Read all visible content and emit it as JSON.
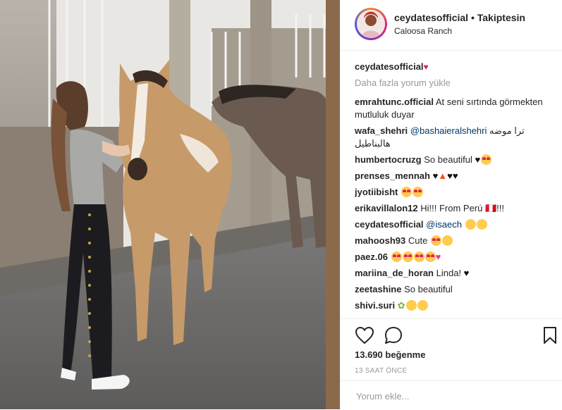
{
  "header": {
    "username": "ceydatesofficial",
    "separator": "•",
    "follow_label": "Takiptesin",
    "location": "Caloosa Ranch"
  },
  "caption": {
    "username": "ceydatesofficial",
    "emoji": "red-heart"
  },
  "load_more": "Daha fazla yorum yükle",
  "comments": [
    {
      "user": "emrahtunc.official",
      "text": "At seni sırtında görmekten mutluluk duyar"
    },
    {
      "user": "wafa_shehri",
      "mention": "@bashaieralshehri",
      "text": "ترا موضه هالبناطيل"
    },
    {
      "user": "humbertocruzg",
      "text": "So beautiful",
      "emojis": "♥😍"
    },
    {
      "user": "prenses_mennah",
      "text": "",
      "emojis": "♥🔥♥♥"
    },
    {
      "user": "jyotiibisht",
      "text": "",
      "emojis": "😍😍"
    },
    {
      "user": "erikavillalon12",
      "text": "Hi!!! From Perú 🇵🇪!!!"
    },
    {
      "user": "ceydatesofficial",
      "mention": "@isaech",
      "text": "",
      "emojis": "😘😘"
    },
    {
      "user": "mahoosh93",
      "text": "Cute",
      "emojis": "😍😘"
    },
    {
      "user": "paez.06",
      "text": "",
      "emojis": "😍😍😍😍💖"
    },
    {
      "user": "mariina_de_horan",
      "text": "Linda!",
      "emojis": "♥"
    },
    {
      "user": "zeetashine",
      "text": "So beautiful"
    },
    {
      "user": "shivi.suri",
      "text": "",
      "emojis": "💐😳😳"
    }
  ],
  "likes": "13.690 beğenme",
  "time_ago": "13 SAAT ÖNCE",
  "add_comment_placeholder": "Yorum ekle...",
  "colors": {
    "link": "#003569",
    "muted": "#999999",
    "text": "#262626"
  }
}
